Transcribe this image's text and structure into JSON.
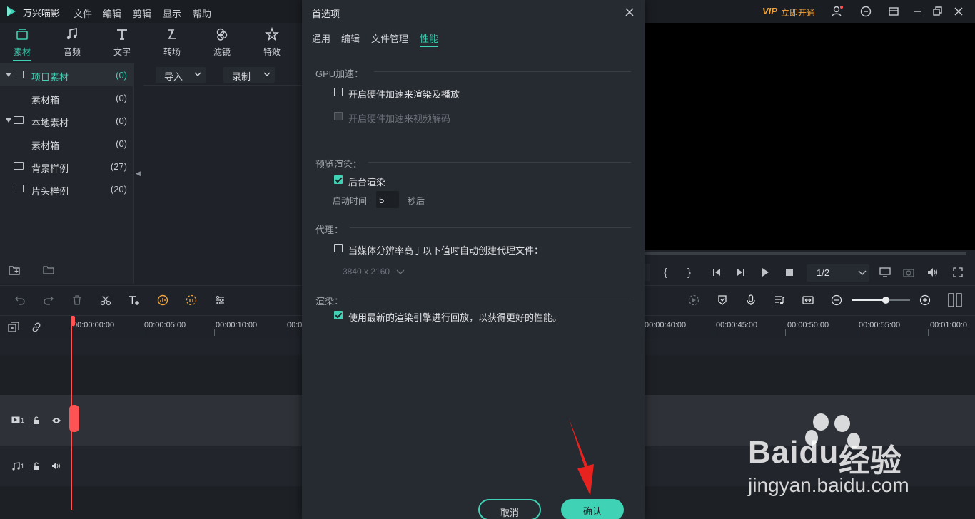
{
  "app": {
    "title": "万兴喵影",
    "menu": [
      "文件",
      "编辑",
      "剪辑",
      "显示",
      "帮助"
    ],
    "vip_badge": "VIP",
    "vip_label": "立即开通"
  },
  "media_tabs": [
    {
      "label": "素材",
      "icon": "media-icon",
      "active": true
    },
    {
      "label": "音频",
      "icon": "music-note-icon"
    },
    {
      "label": "文字",
      "icon": "text-icon"
    },
    {
      "label": "转场",
      "icon": "transition-icon"
    },
    {
      "label": "滤镜",
      "icon": "filter-icon"
    },
    {
      "label": "特效",
      "icon": "effects-icon"
    }
  ],
  "tree": [
    {
      "label": "项目素材",
      "count": "(0)",
      "expanded": true,
      "selected": true
    },
    {
      "label": "素材箱",
      "count": "(0)",
      "child": true
    },
    {
      "label": "本地素材",
      "count": "(0)",
      "expanded": true
    },
    {
      "label": "素材箱",
      "count": "(0)",
      "child": true
    },
    {
      "label": "背景样例",
      "count": "(27)"
    },
    {
      "label": "片头样例",
      "count": "(20)"
    }
  ],
  "media_toolbar": {
    "import_label": "导入",
    "record_label": "录制"
  },
  "preview": {
    "page": "1/2",
    "mark_in": "{",
    "mark_out": "}"
  },
  "ruler": {
    "ticks": [
      "00:00:00:00",
      "00:00:05:00",
      "00:00:10:00",
      "00:0",
      "00:00:40:00",
      "00:00:45:00",
      "00:00:50:00",
      "00:00:55:00",
      "00:01:00:0"
    ]
  },
  "tracks": {
    "video_label": "1",
    "audio_label": "1"
  },
  "dialog": {
    "title": "首选项",
    "tabs": [
      "通用",
      "编辑",
      "文件管理",
      "性能"
    ],
    "active_tab": "性能",
    "gpu": {
      "title": "GPU加速：",
      "hw_render": {
        "label": "开启硬件加速来渲染及播放",
        "checked": false
      },
      "hw_decode": {
        "label": "开启硬件加速来视频解码",
        "checked": false,
        "disabled": true
      }
    },
    "preview_render": {
      "title": "预览渲染：",
      "background": {
        "label": "后台渲染",
        "checked": true
      },
      "delay_label": "启动时间",
      "delay_value": "5",
      "delay_unit": "秒后"
    },
    "proxy": {
      "title": "代理：",
      "auto_proxy": {
        "label": "当媒体分辨率高于以下值时自动创建代理文件：",
        "checked": false
      },
      "resolution": "3840 x 2160"
    },
    "render": {
      "title": "渲染：",
      "latest_engine": {
        "label": "使用最新的渲染引擎进行回放，以获得更好的性能。",
        "checked": true
      }
    },
    "cancel_label": "取消",
    "confirm_label": "确认"
  },
  "watermark": {
    "bai": "Bai",
    "du": "du",
    "jingyan": "经验",
    "url": "jingyan.baidu.com"
  },
  "colors": {
    "accent": "#3fd2b4",
    "vip": "#f2a53a",
    "playhead": "#ff5252",
    "arrow": "#e8231f"
  }
}
